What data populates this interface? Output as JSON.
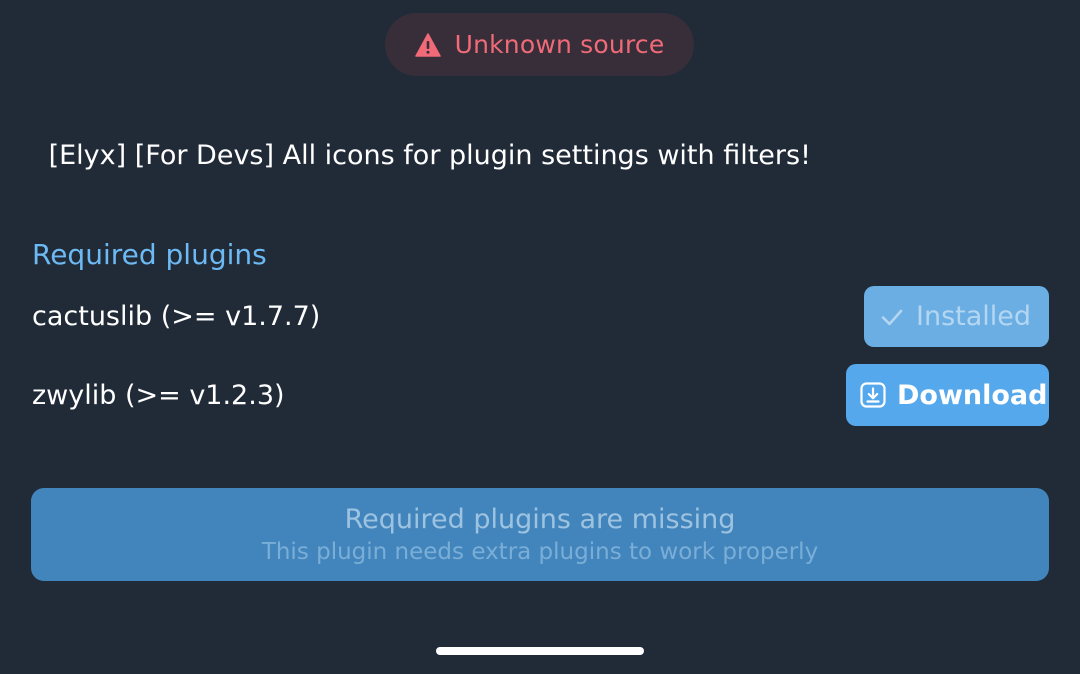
{
  "source_badge": {
    "icon": "warning-icon",
    "text": "Unknown source",
    "color": "#f06a78"
  },
  "plugin": {
    "title": " [Elyx] [For Devs] All icons for plugin settings with filters!"
  },
  "required_plugins": {
    "heading": "Required plugins",
    "items": [
      {
        "name": "cactuslib (>= v1.7.7)",
        "action_label": "Installed",
        "action_icon": "check-icon",
        "state": "installed"
      },
      {
        "name": "zwylib (>= v1.2.3)",
        "action_label": "Download",
        "action_icon": "download-icon",
        "state": "not-installed"
      }
    ]
  },
  "status_banner": {
    "title": "Required plugins are missing",
    "subtitle": "This plugin needs extra plugins to work properly"
  },
  "colors": {
    "background": "#212b38",
    "accent": "#55a8ec",
    "heading": "#6cb9f3"
  }
}
